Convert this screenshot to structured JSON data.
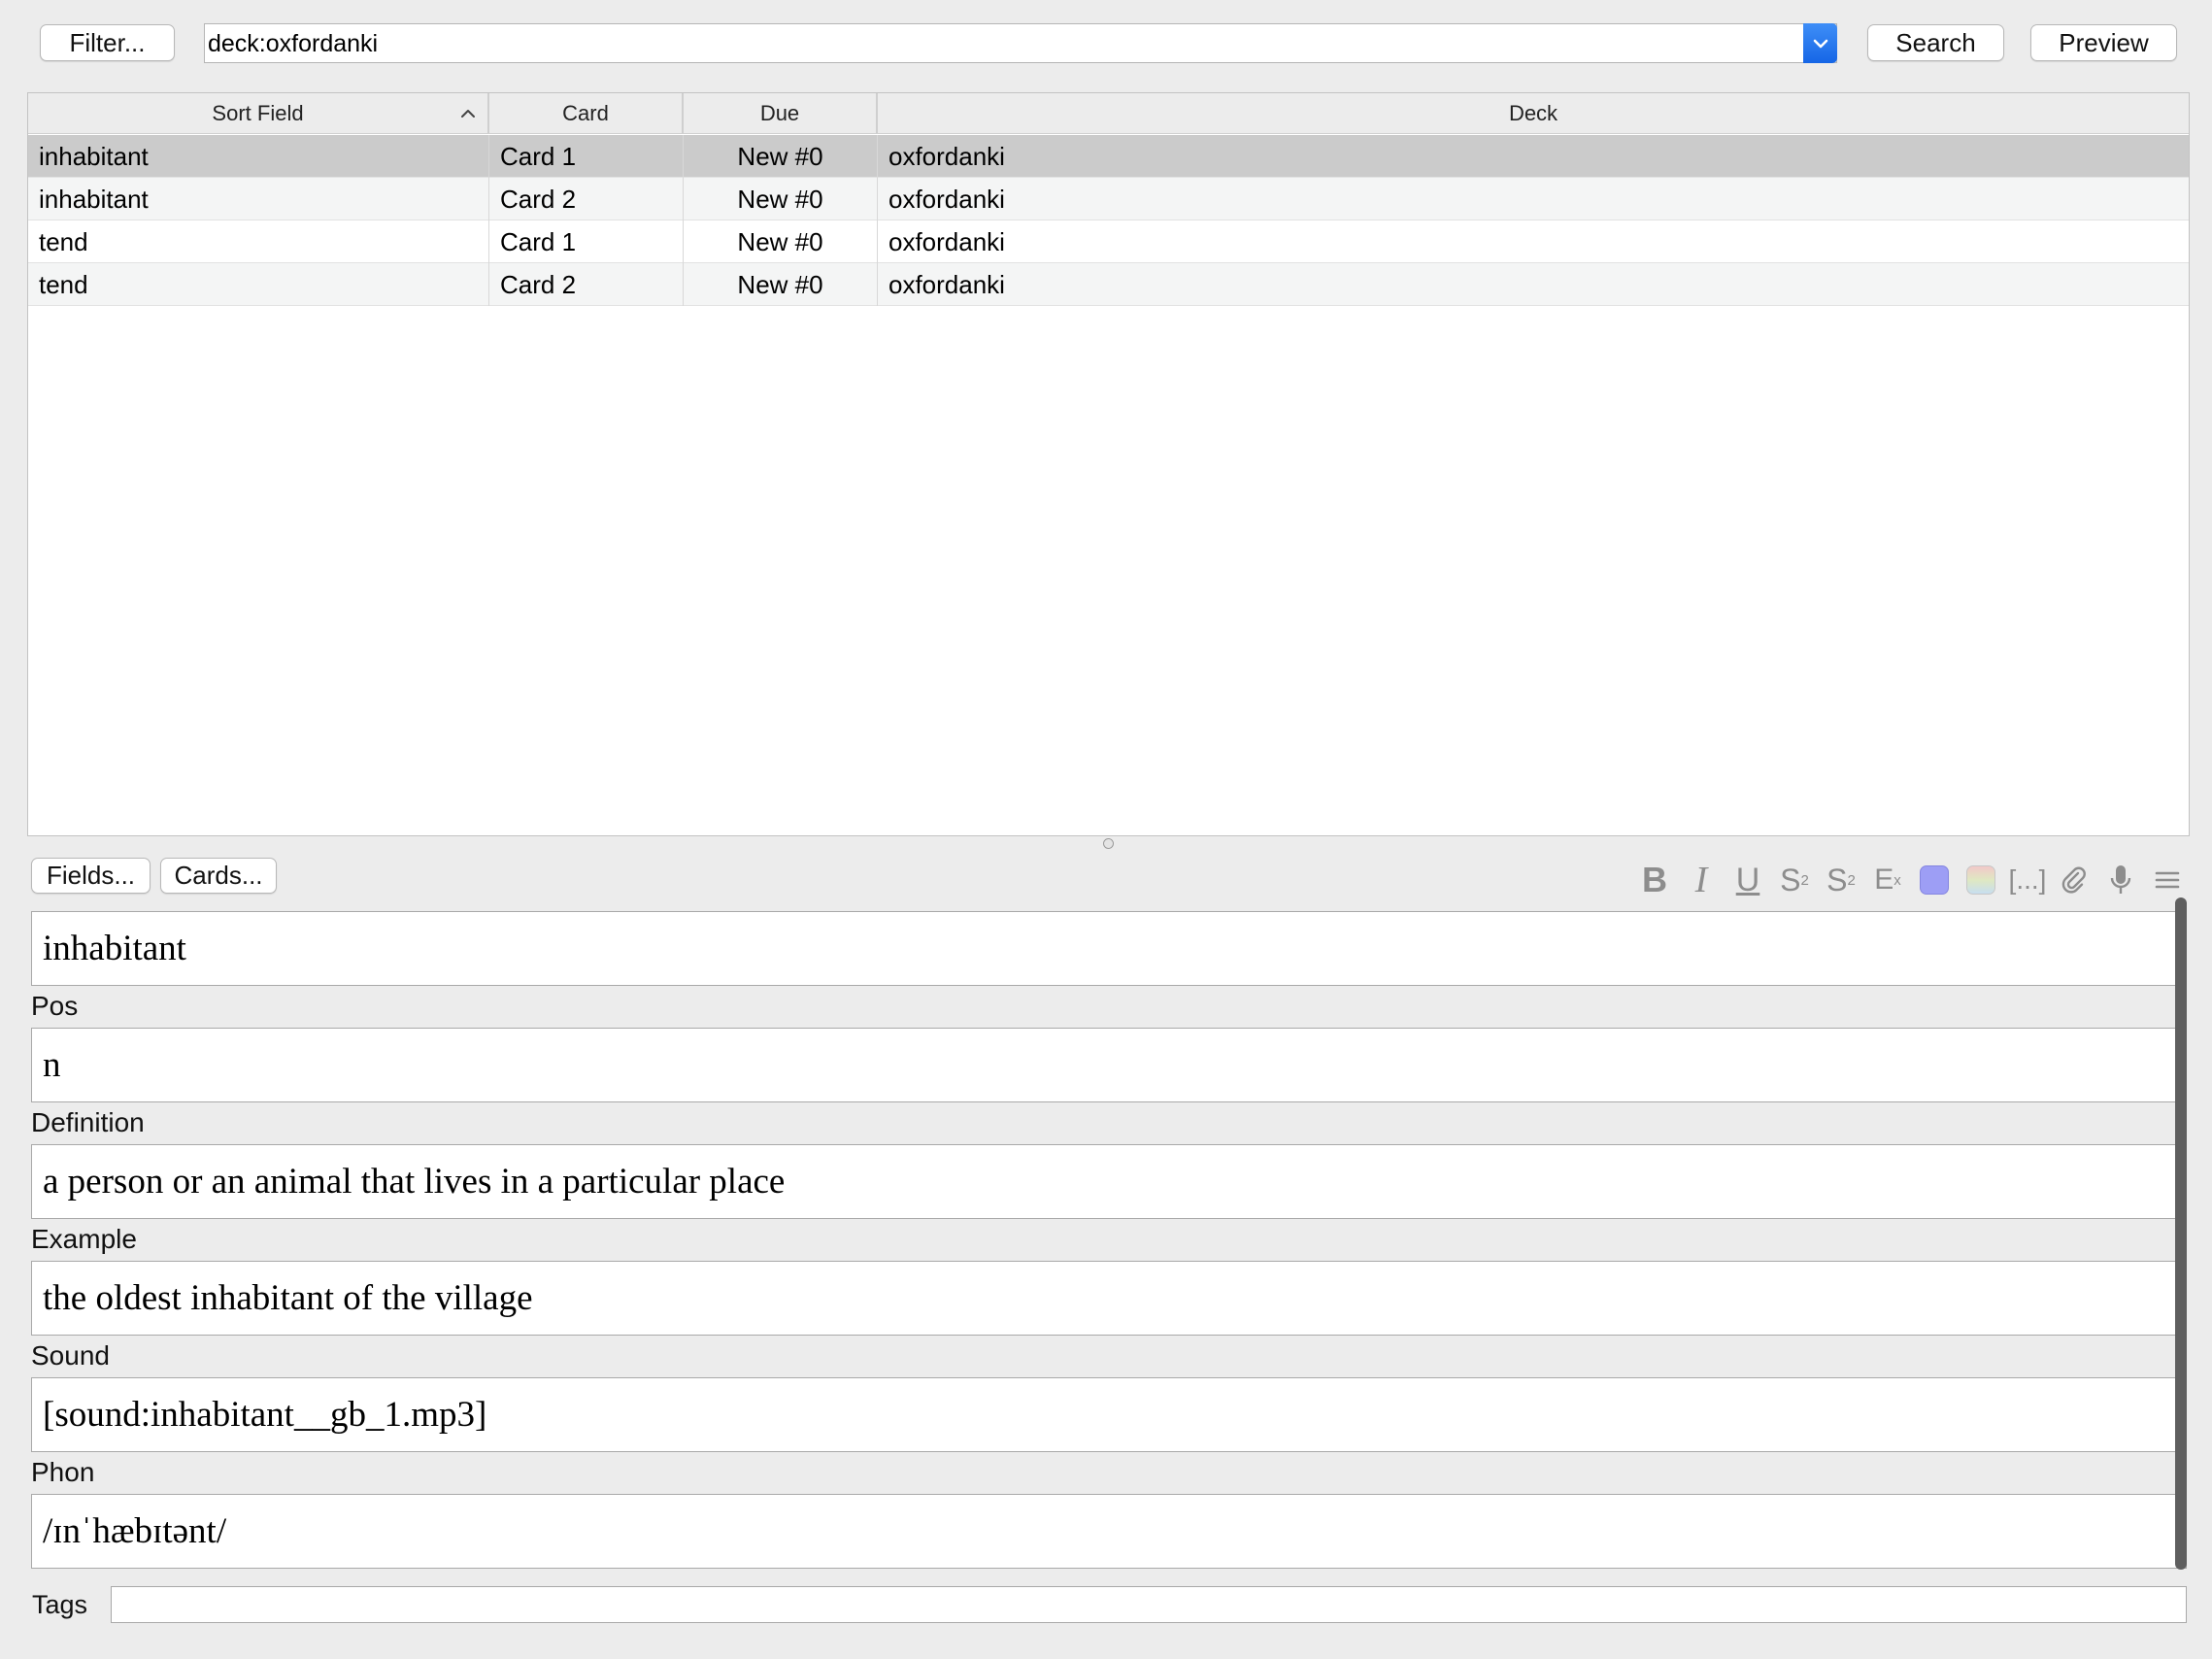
{
  "search": {
    "filter_label": "Filter...",
    "query": "deck:oxfordanki",
    "search_label": "Search",
    "preview_label": "Preview"
  },
  "table": {
    "columns": [
      "Sort Field",
      "Card",
      "Due",
      "Deck"
    ],
    "rows": [
      {
        "sort_field": "inhabitant",
        "card": "Card 1",
        "due": "New #0",
        "deck": "oxfordanki"
      },
      {
        "sort_field": "inhabitant",
        "card": "Card 2",
        "due": "New #0",
        "deck": "oxfordanki"
      },
      {
        "sort_field": "tend",
        "card": "Card 1",
        "due": "New #0",
        "deck": "oxfordanki"
      },
      {
        "sort_field": "tend",
        "card": "Card 2",
        "due": "New #0",
        "deck": "oxfordanki"
      }
    ]
  },
  "editor": {
    "fields_label": "Fields...",
    "cards_label": "Cards...",
    "fields": [
      {
        "label": "",
        "value": "inhabitant"
      },
      {
        "label": "Pos",
        "value": "n"
      },
      {
        "label": "Definition",
        "value": "a person or an animal that lives in a particular place"
      },
      {
        "label": "Example",
        "value": "the oldest inhabitant of the village"
      },
      {
        "label": "Sound",
        "value": "[sound:inhabitant__gb_1.mp3]"
      },
      {
        "label": "Phon",
        "value": "/ɪnˈhæbɪtənt/"
      }
    ],
    "tags_label": "Tags",
    "tags_value": ""
  },
  "toolbar_icons": [
    "bold-icon",
    "italic-icon",
    "underline-icon",
    "superscript-icon",
    "subscript-icon",
    "clear-format-icon",
    "text-color-icon",
    "highlight-color-icon",
    "cloze-icon",
    "attach-icon",
    "record-icon",
    "more-icon"
  ],
  "colors": {
    "accent": "#1f73eb",
    "selected_row": "#cbcbcb",
    "text_color_swatch": "#9d9ef5",
    "toolbar_icon": "#8d8d8d"
  }
}
